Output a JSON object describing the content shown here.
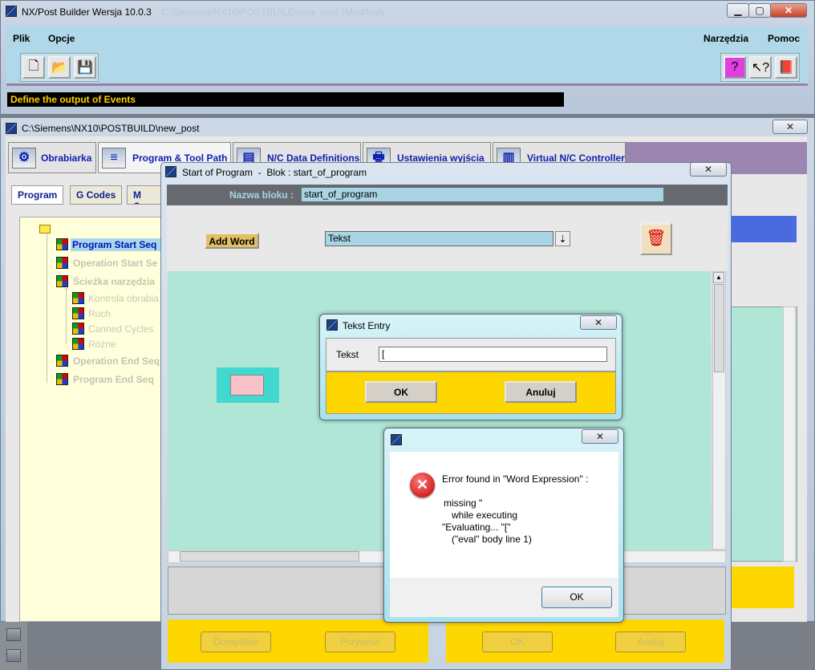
{
  "main_window": {
    "title": "NX/Post Builder Wersja 10.0.3",
    "title_ghost": "C:\\Siemens\\NX10\\POSTBUILD\\new_post (Modified)",
    "menu": {
      "file": "Plik",
      "options": "Opcje",
      "tools": "Narzędzia",
      "help": "Pomoc"
    },
    "status": "Define the output of Events"
  },
  "post_window": {
    "title": "C:\\Siemens\\NX10\\POSTBUILD\\new_post",
    "tabs": [
      "Obrabiarka",
      "Program & Tool Path",
      "N/C Data Definitions",
      "Ustawienia wyjścia",
      "Virtual N/C Controller"
    ],
    "subtabs": [
      "Program",
      "G Codes",
      "M Co"
    ],
    "tree": [
      {
        "label": "Program Start Seq",
        "state": "active"
      },
      {
        "label": "Operation Start Se",
        "state": "disabled"
      },
      {
        "label": "Ścieżka narzędzia",
        "state": "disabled"
      },
      {
        "label": "Kontrola obrabia",
        "state": "disabled"
      },
      {
        "label": "Ruch",
        "state": "disabled"
      },
      {
        "label": "Canned Cycles",
        "state": "disabled"
      },
      {
        "label": "Różne",
        "state": "disabled"
      },
      {
        "label": "Operation End Seq",
        "state": "disabled"
      },
      {
        "label": "Program End Seq",
        "state": "disabled"
      }
    ]
  },
  "block_window": {
    "title": "Start of Program  -  Blok : start_of_program",
    "name_label": "Nazwa bloku  :",
    "name_value": "start_of_program",
    "add_word": "Add Word",
    "word_select": "Tekst",
    "bottom_buttons": [
      "Domyślnie",
      "Przywróć",
      "OK",
      "Anuluj"
    ]
  },
  "text_entry": {
    "title": "Tekst Entry",
    "label": "Tekst",
    "value": "[",
    "ok": "OK",
    "cancel": "Anuluj"
  },
  "error": {
    "heading": "Error found in \"Word Expression\" :",
    "line1": "missing \"",
    "line2": "while executing",
    "line3": "\"Evaluating... \"[\"",
    "line4": "(\"eval\" body line 1)",
    "ok": "OK"
  },
  "colors": {
    "teal_panel": "#b0e6d6",
    "yellow_panel": "#ffd700",
    "title_blue": "#a8d4e4",
    "status_bg": "#000000",
    "status_fg": "#ffd000"
  }
}
